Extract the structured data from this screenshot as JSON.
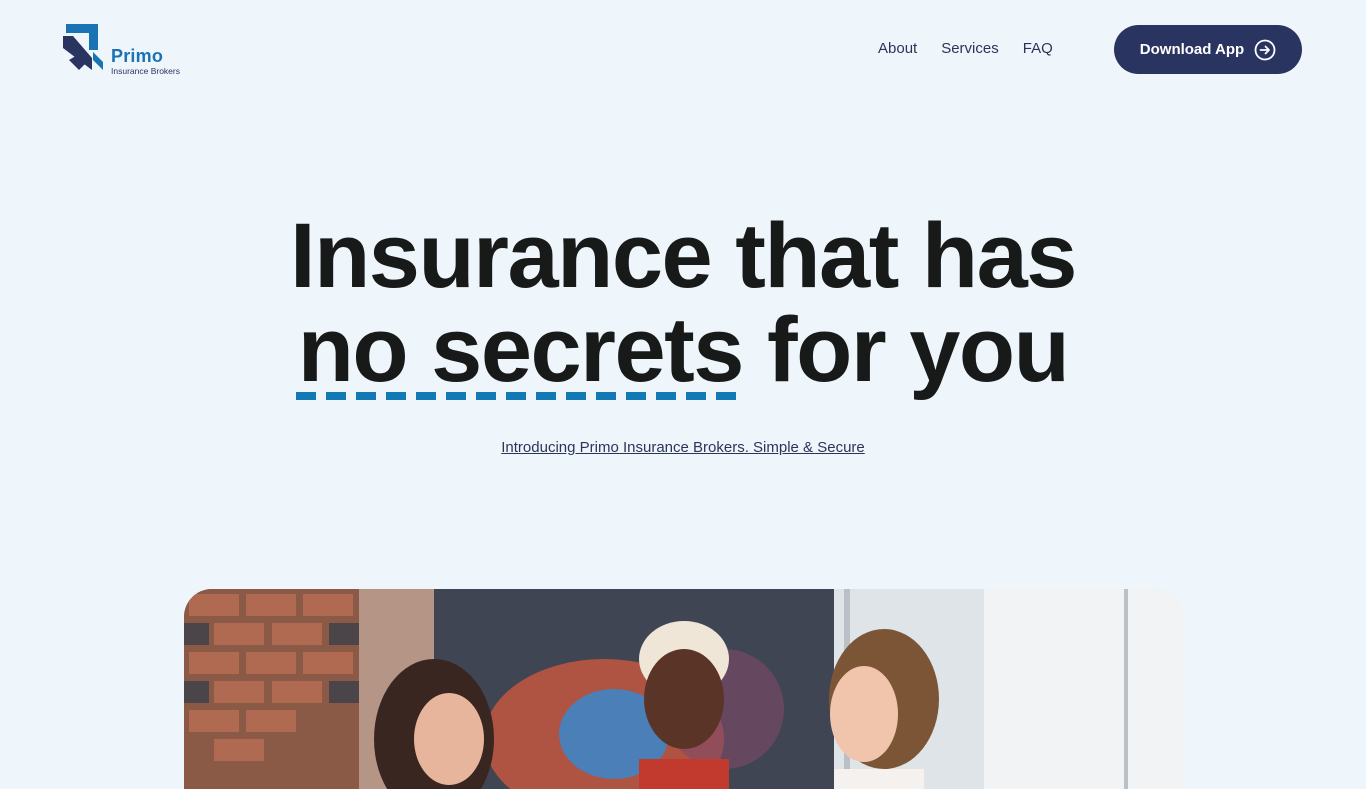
{
  "brand": {
    "name": "Primo",
    "subtitle": "Insurance Brokers"
  },
  "nav": {
    "items": [
      {
        "label": "About"
      },
      {
        "label": "Services"
      },
      {
        "label": "FAQ"
      }
    ]
  },
  "cta": {
    "label": "Download App",
    "icon": "arrow-right-circle-icon"
  },
  "hero": {
    "line1": "Insurance that has",
    "line2_accent": "no secrets",
    "line2_rest": "for you",
    "tagline": "Introducing Primo Insurance Brokers. Simple & Secure"
  },
  "colors": {
    "background": "#eff6fb",
    "primary_dark": "#2a3460",
    "accent_blue": "#1379b5",
    "heading": "#171a19"
  }
}
